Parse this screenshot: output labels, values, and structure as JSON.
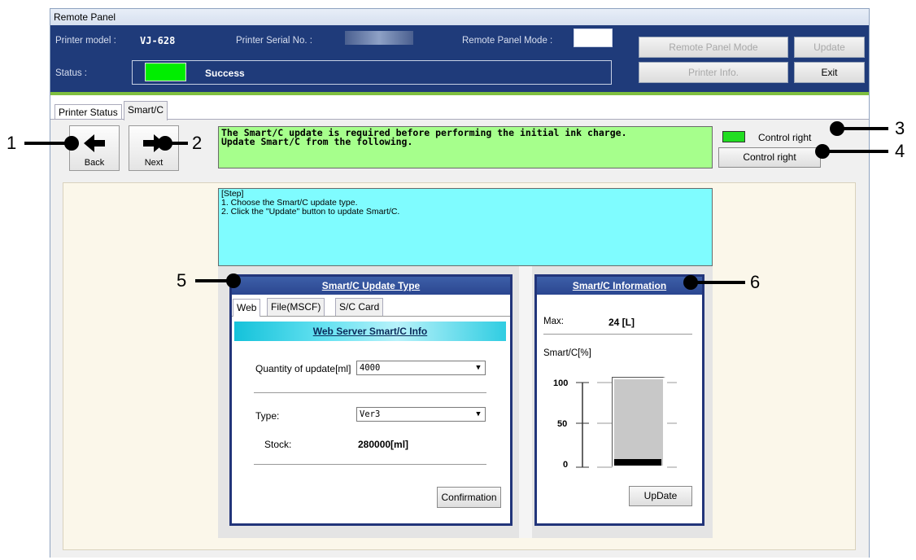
{
  "window": {
    "title": "Remote Panel"
  },
  "header": {
    "printer_model_label": "Printer model :",
    "printer_model_value": "VJ-628",
    "serial_label": "Printer Serial No. :",
    "remote_mode_label": "Remote Panel Mode :",
    "status_label": "Status :",
    "status_value": "Success",
    "status_color": "#00ee00",
    "buttons": {
      "remote_panel_mode": "Remote Panel Mode",
      "update": "Update",
      "printer_info": "Printer Info.",
      "exit": "Exit"
    }
  },
  "tabs": [
    "Printer Status",
    "Smart/C"
  ],
  "toolbar": {
    "back_label": "Back",
    "next_label": "Next",
    "message": "The Smart/C update is required before performing the initial ink charge.\nUpdate Smart/C from the following.",
    "control_right_indicator": "Control right",
    "control_right_button": "Control right",
    "indicator_color": "#22dd22"
  },
  "step": {
    "lines": [
      "[Step]",
      "1. Choose the Smart/C update type.",
      "2. Click the \"Update\" button to update Smart/C."
    ]
  },
  "update_type": {
    "title": "Smart/C Update Type",
    "tabs": [
      "Web",
      "File(MSCF)",
      "S/C Card"
    ],
    "subtitle": "Web Server Smart/C Info",
    "quantity_label": "Quantity of update[ml]",
    "quantity_value": "4000",
    "type_label": "Type:",
    "type_value": "Ver3",
    "stock_label": "Stock:",
    "stock_value": "280000[ml]",
    "confirm_label": "Confirmation"
  },
  "information": {
    "title": "Smart/C Information",
    "max_label": "Max:",
    "max_value": "24 [L]",
    "gauge_label": "Smart/C[%]",
    "ticks": [
      "100",
      "50",
      "0"
    ],
    "level_percent": 8,
    "update_label": "UpDate"
  },
  "callouts": [
    "1",
    "2",
    "3",
    "4",
    "5",
    "6"
  ]
}
